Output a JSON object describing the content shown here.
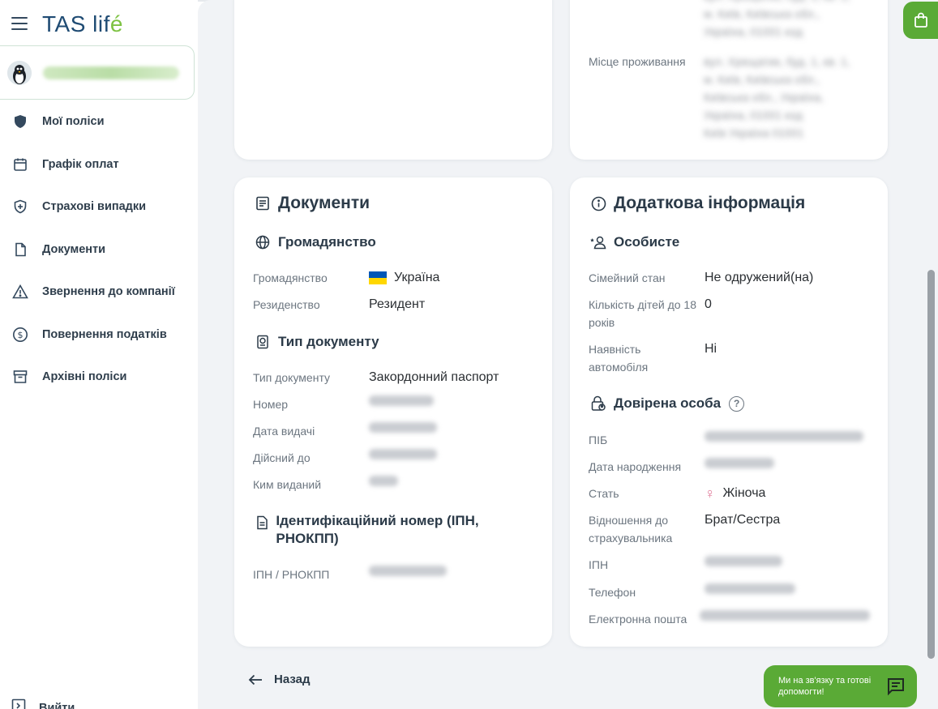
{
  "app": {
    "logo_main": "TAS",
    "logo_sub": "lif",
    "logo_accent": "é",
    "accent_color": "#5aaa36",
    "brand_color": "#1f4b73"
  },
  "sidebar": {
    "user_name": "ПІБ користувача",
    "items": [
      {
        "label": "Мої поліси",
        "icon": "shield-filled-icon"
      },
      {
        "label": "Графік оплат",
        "icon": "calendar-icon"
      },
      {
        "label": "Страхові випадки",
        "icon": "shield-plus-icon"
      },
      {
        "label": "Документи",
        "icon": "file-icon"
      },
      {
        "label": "Звернення до компанії",
        "icon": "warning-icon"
      },
      {
        "label": "Повернення податків",
        "icon": "dollar-circle-icon"
      },
      {
        "label": "Архівні поліси",
        "icon": "archive-icon"
      }
    ],
    "logout_label": "Вийти"
  },
  "top_cards": {
    "residence_label": "Місце проживання"
  },
  "documents": {
    "title": "Документи",
    "citizenship_title": "Громадянство",
    "citizenship_label": "Громадянство",
    "citizenship_value": "Україна",
    "residency_label": "Резиденство",
    "residency_value": "Резидент",
    "doc_type_title": "Тип документу",
    "doc_type_label": "Тип документу",
    "doc_type_value": "Закордонний паспорт",
    "number_label": "Номер",
    "issue_date_label": "Дата видачі",
    "valid_until_label": "Дійсний до",
    "issued_by_label": "Ким виданий",
    "ipn_title": "Ідентифікаційний номер (ІПН, РНОКПП)",
    "ipn_label": "ІПН / РНОКПП"
  },
  "info": {
    "title": "Додаткова інформація",
    "personal_title": "Особисте",
    "marital_label": "Сімейний стан",
    "marital_value": "Не одружений(на)",
    "children_label": "Кількість дітей до 18 років",
    "children_value": "0",
    "car_label": "Наявність автомобіля",
    "car_value": "Ні",
    "trusted_title": "Довірена особа",
    "pib_label": "ПІБ",
    "birth_label": "Дата народження",
    "gender_label": "Стать",
    "gender_value": "Жіноча",
    "relation_label": "Відношення до страхувальника",
    "relation_value": "Брат/Сестра",
    "ipn_label": "ІПН",
    "phone_label": "Телефон",
    "email_label": "Електронна пошта"
  },
  "footer": {
    "back_label": "Назад",
    "chat_text": "Ми на зв'язку та готові допомогти!"
  }
}
